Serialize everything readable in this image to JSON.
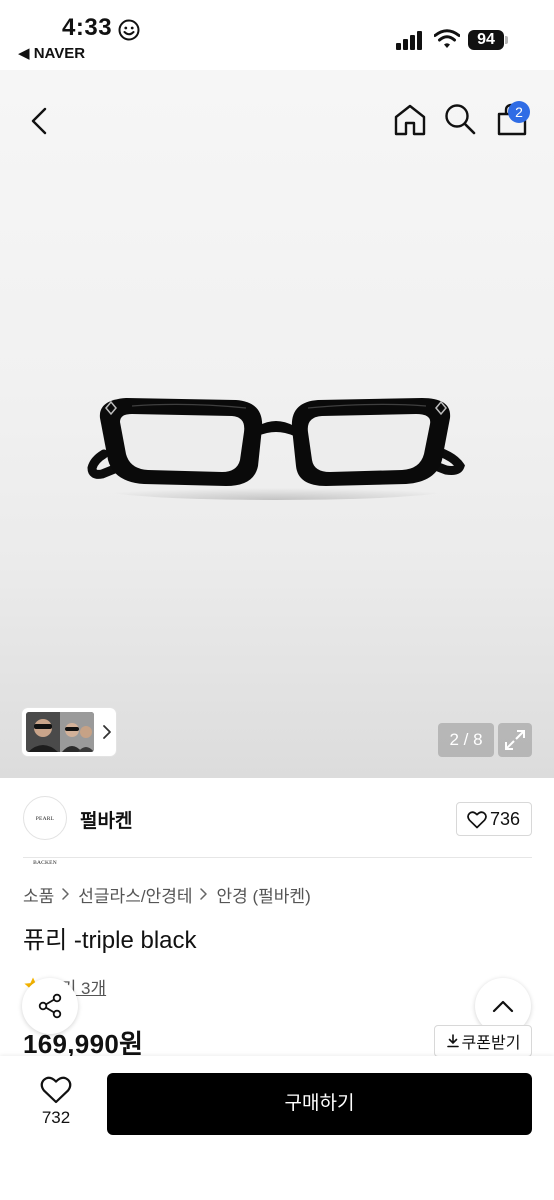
{
  "status_bar": {
    "time": "4:33",
    "back_app": "◀ NAVER",
    "battery": "94"
  },
  "nav": {
    "cart_count": "2",
    "icons": [
      "back-chevron-icon",
      "home-icon",
      "search-icon",
      "shopping-bag-icon"
    ]
  },
  "gallery": {
    "counter": "2 / 8",
    "current": 2,
    "total": 8
  },
  "brand": {
    "logo_text": "PEARL BACKEN",
    "name": "펄바켄",
    "likes": "736"
  },
  "breadcrumb": [
    "소품",
    "선글라스/안경테",
    "안경 (펄바켄)"
  ],
  "product": {
    "title": "퓨리 -triple black",
    "review_link": "후기 3개",
    "price": "169,990원",
    "coupon_label": "쿠폰받기"
  },
  "bottom_bar": {
    "wish_count": "732",
    "buy_label": "구매하기"
  },
  "colors": {
    "accent_badge": "#2f6ce5",
    "buy_button": "#000000",
    "star": "#f5b400"
  }
}
